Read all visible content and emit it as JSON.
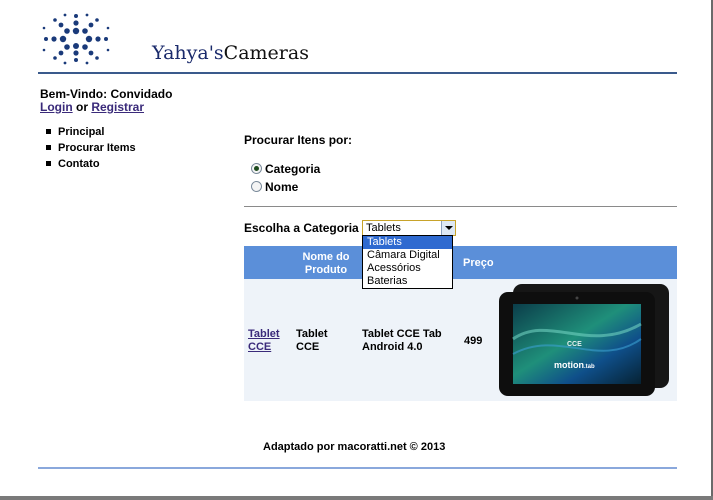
{
  "logo": {
    "text_primary": "Yahya's",
    "text_secondary": "Cameras",
    "icon": "starburst-logo-icon"
  },
  "welcome": {
    "text": "Bem-Vindo: Convidado"
  },
  "auth": {
    "login": "Login",
    "separator": " or ",
    "register": "Registrar"
  },
  "nav": {
    "items": [
      {
        "label": "Principal"
      },
      {
        "label": "Procurar Items"
      },
      {
        "label": "Contato"
      }
    ]
  },
  "search": {
    "title": "Procurar Itens por:",
    "options": [
      {
        "label": "Categoria",
        "checked": true
      },
      {
        "label": "Nome",
        "checked": false
      }
    ]
  },
  "category": {
    "label": "Escolha a Categoria",
    "selected": "Tablets",
    "options": [
      "Tablets",
      "Câmara Digital",
      "Acessórios",
      "Baterias"
    ]
  },
  "table": {
    "headers": [
      "",
      "Nome do Produto",
      "",
      "Preço",
      ""
    ],
    "header_name_line1": "Nome do",
    "header_name_line2": "Produto",
    "rows": [
      {
        "link_line1": "Tablet",
        "link_line2": "CCE",
        "name_line1": "Tablet",
        "name_line2": "CCE",
        "desc_line1": "Tablet CCE Tab",
        "desc_line2": "Android 4.0",
        "price": "499",
        "screen_brand": "CCE",
        "screen_model": "motion",
        "screen_model_suffix": ".tab"
      }
    ]
  },
  "footer": {
    "text": "Adaptado por macoratti.net © 2013"
  },
  "colors": {
    "table_header": "#5b8fd9",
    "row_bg": "#eef3f9",
    "accent_rule": "#3a5a8c",
    "link": "#3a2a7a",
    "dropdown_selected": "#2f6ad0"
  }
}
